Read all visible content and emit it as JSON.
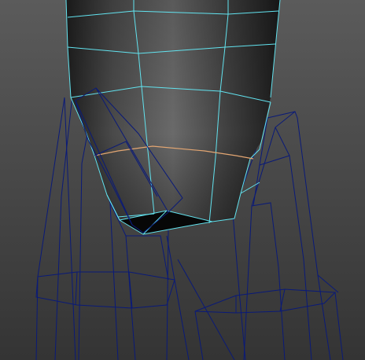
{
  "viewport": {
    "background_top": "#5b5b5b",
    "background_bottom": "#343434"
  },
  "colors": {
    "selected_wire": "#62e3ef",
    "unselected_wire": "#0a1a78",
    "edge_highlight": "#e3a672",
    "mesh_light": "#6a6a6a",
    "mesh_dark": "#1e1e1e",
    "face_black": "#070707"
  }
}
